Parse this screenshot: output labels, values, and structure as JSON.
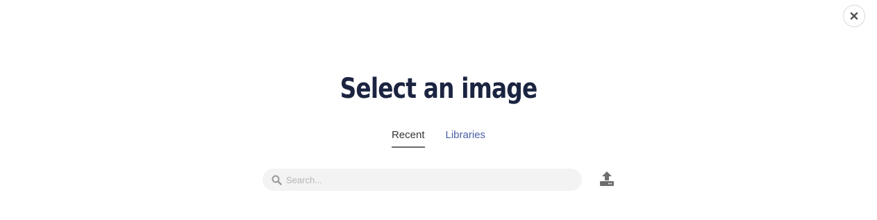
{
  "dialog": {
    "title": "Select an image",
    "close_icon": "close-icon"
  },
  "tabs": [
    {
      "label": "Recent",
      "active": true
    },
    {
      "label": "Libraries",
      "active": false
    }
  ],
  "search": {
    "placeholder": "Search...",
    "value": "",
    "icon": "search-icon"
  },
  "upload": {
    "icon": "upload-icon"
  },
  "colors": {
    "title": "#1b2440",
    "link": "#4a5fa6",
    "search_bg": "#f3f3f3"
  }
}
